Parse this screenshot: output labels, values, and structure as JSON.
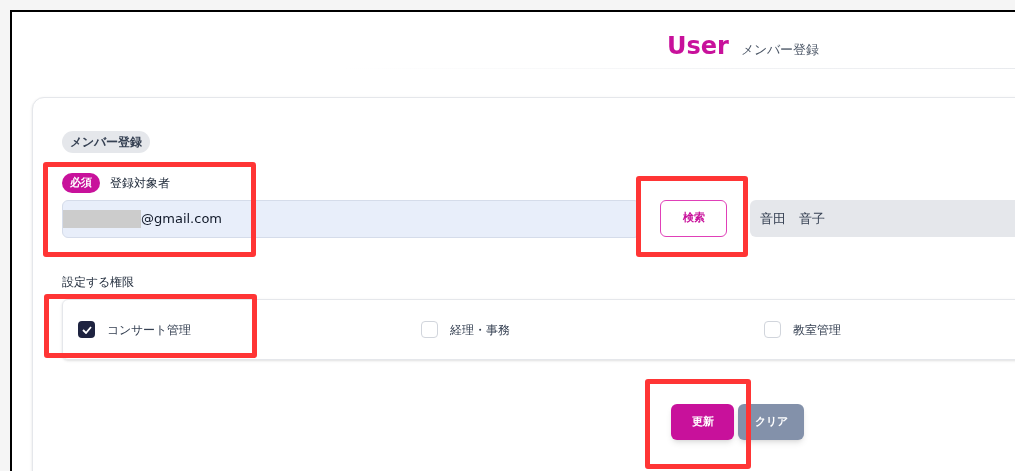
{
  "header": {
    "title": "User",
    "subtitle": "メンバー登録"
  },
  "section_badge": "メンバー登録",
  "target_field": {
    "required_badge": "必須",
    "label": "登録対象者",
    "value": "@gmail.com",
    "redacted": true,
    "highlighted": true
  },
  "search_button": {
    "label": "検索",
    "highlighted": true
  },
  "name_field": {
    "value": "音田　音子"
  },
  "permissions": {
    "label": "設定する権限",
    "options": [
      {
        "label": "コンサート管理",
        "checked": true,
        "highlighted": true
      },
      {
        "label": "経理・事務",
        "checked": false,
        "highlighted": false
      },
      {
        "label": "教室管理",
        "checked": false,
        "highlighted": false
      }
    ]
  },
  "buttons": [
    {
      "label": "更新",
      "kind": "primary",
      "highlighted": true
    },
    {
      "label": "クリア",
      "kind": "secondary",
      "highlighted": false
    }
  ]
}
